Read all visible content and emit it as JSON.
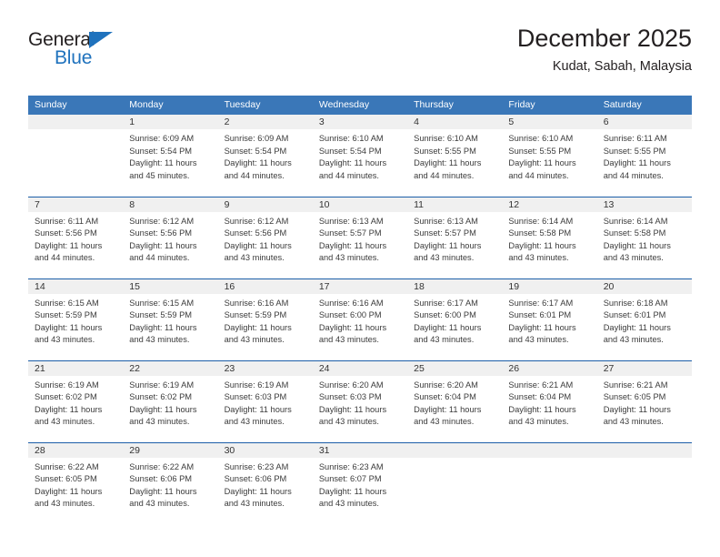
{
  "brand": {
    "name_part1": "General",
    "name_part2": "Blue",
    "triangle_color": "#1f72bd",
    "text_color": "#231f20"
  },
  "header": {
    "title": "December 2025",
    "subtitle": "Kudat, Sabah, Malaysia"
  },
  "theme": {
    "header_bg": "#3a77b8",
    "row_separator": "#1c5ea8",
    "daynum_bg": "#f0f0f0",
    "body_text": "#3b3b3b"
  },
  "weekday_headers": [
    "Sunday",
    "Monday",
    "Tuesday",
    "Wednesday",
    "Thursday",
    "Friday",
    "Saturday"
  ],
  "weeks": [
    [
      {
        "day": "",
        "sunrise": "",
        "sunset": "",
        "daylight_line1": "",
        "daylight_line2": "",
        "empty": true
      },
      {
        "day": "1",
        "sunrise": "Sunrise: 6:09 AM",
        "sunset": "Sunset: 5:54 PM",
        "daylight_line1": "Daylight: 11 hours",
        "daylight_line2": "and 45 minutes.",
        "empty": false
      },
      {
        "day": "2",
        "sunrise": "Sunrise: 6:09 AM",
        "sunset": "Sunset: 5:54 PM",
        "daylight_line1": "Daylight: 11 hours",
        "daylight_line2": "and 44 minutes.",
        "empty": false
      },
      {
        "day": "3",
        "sunrise": "Sunrise: 6:10 AM",
        "sunset": "Sunset: 5:54 PM",
        "daylight_line1": "Daylight: 11 hours",
        "daylight_line2": "and 44 minutes.",
        "empty": false
      },
      {
        "day": "4",
        "sunrise": "Sunrise: 6:10 AM",
        "sunset": "Sunset: 5:55 PM",
        "daylight_line1": "Daylight: 11 hours",
        "daylight_line2": "and 44 minutes.",
        "empty": false
      },
      {
        "day": "5",
        "sunrise": "Sunrise: 6:10 AM",
        "sunset": "Sunset: 5:55 PM",
        "daylight_line1": "Daylight: 11 hours",
        "daylight_line2": "and 44 minutes.",
        "empty": false
      },
      {
        "day": "6",
        "sunrise": "Sunrise: 6:11 AM",
        "sunset": "Sunset: 5:55 PM",
        "daylight_line1": "Daylight: 11 hours",
        "daylight_line2": "and 44 minutes.",
        "empty": false
      }
    ],
    [
      {
        "day": "7",
        "sunrise": "Sunrise: 6:11 AM",
        "sunset": "Sunset: 5:56 PM",
        "daylight_line1": "Daylight: 11 hours",
        "daylight_line2": "and 44 minutes.",
        "empty": false
      },
      {
        "day": "8",
        "sunrise": "Sunrise: 6:12 AM",
        "sunset": "Sunset: 5:56 PM",
        "daylight_line1": "Daylight: 11 hours",
        "daylight_line2": "and 44 minutes.",
        "empty": false
      },
      {
        "day": "9",
        "sunrise": "Sunrise: 6:12 AM",
        "sunset": "Sunset: 5:56 PM",
        "daylight_line1": "Daylight: 11 hours",
        "daylight_line2": "and 43 minutes.",
        "empty": false
      },
      {
        "day": "10",
        "sunrise": "Sunrise: 6:13 AM",
        "sunset": "Sunset: 5:57 PM",
        "daylight_line1": "Daylight: 11 hours",
        "daylight_line2": "and 43 minutes.",
        "empty": false
      },
      {
        "day": "11",
        "sunrise": "Sunrise: 6:13 AM",
        "sunset": "Sunset: 5:57 PM",
        "daylight_line1": "Daylight: 11 hours",
        "daylight_line2": "and 43 minutes.",
        "empty": false
      },
      {
        "day": "12",
        "sunrise": "Sunrise: 6:14 AM",
        "sunset": "Sunset: 5:58 PM",
        "daylight_line1": "Daylight: 11 hours",
        "daylight_line2": "and 43 minutes.",
        "empty": false
      },
      {
        "day": "13",
        "sunrise": "Sunrise: 6:14 AM",
        "sunset": "Sunset: 5:58 PM",
        "daylight_line1": "Daylight: 11 hours",
        "daylight_line2": "and 43 minutes.",
        "empty": false
      }
    ],
    [
      {
        "day": "14",
        "sunrise": "Sunrise: 6:15 AM",
        "sunset": "Sunset: 5:59 PM",
        "daylight_line1": "Daylight: 11 hours",
        "daylight_line2": "and 43 minutes.",
        "empty": false
      },
      {
        "day": "15",
        "sunrise": "Sunrise: 6:15 AM",
        "sunset": "Sunset: 5:59 PM",
        "daylight_line1": "Daylight: 11 hours",
        "daylight_line2": "and 43 minutes.",
        "empty": false
      },
      {
        "day": "16",
        "sunrise": "Sunrise: 6:16 AM",
        "sunset": "Sunset: 5:59 PM",
        "daylight_line1": "Daylight: 11 hours",
        "daylight_line2": "and 43 minutes.",
        "empty": false
      },
      {
        "day": "17",
        "sunrise": "Sunrise: 6:16 AM",
        "sunset": "Sunset: 6:00 PM",
        "daylight_line1": "Daylight: 11 hours",
        "daylight_line2": "and 43 minutes.",
        "empty": false
      },
      {
        "day": "18",
        "sunrise": "Sunrise: 6:17 AM",
        "sunset": "Sunset: 6:00 PM",
        "daylight_line1": "Daylight: 11 hours",
        "daylight_line2": "and 43 minutes.",
        "empty": false
      },
      {
        "day": "19",
        "sunrise": "Sunrise: 6:17 AM",
        "sunset": "Sunset: 6:01 PM",
        "daylight_line1": "Daylight: 11 hours",
        "daylight_line2": "and 43 minutes.",
        "empty": false
      },
      {
        "day": "20",
        "sunrise": "Sunrise: 6:18 AM",
        "sunset": "Sunset: 6:01 PM",
        "daylight_line1": "Daylight: 11 hours",
        "daylight_line2": "and 43 minutes.",
        "empty": false
      }
    ],
    [
      {
        "day": "21",
        "sunrise": "Sunrise: 6:19 AM",
        "sunset": "Sunset: 6:02 PM",
        "daylight_line1": "Daylight: 11 hours",
        "daylight_line2": "and 43 minutes.",
        "empty": false
      },
      {
        "day": "22",
        "sunrise": "Sunrise: 6:19 AM",
        "sunset": "Sunset: 6:02 PM",
        "daylight_line1": "Daylight: 11 hours",
        "daylight_line2": "and 43 minutes.",
        "empty": false
      },
      {
        "day": "23",
        "sunrise": "Sunrise: 6:19 AM",
        "sunset": "Sunset: 6:03 PM",
        "daylight_line1": "Daylight: 11 hours",
        "daylight_line2": "and 43 minutes.",
        "empty": false
      },
      {
        "day": "24",
        "sunrise": "Sunrise: 6:20 AM",
        "sunset": "Sunset: 6:03 PM",
        "daylight_line1": "Daylight: 11 hours",
        "daylight_line2": "and 43 minutes.",
        "empty": false
      },
      {
        "day": "25",
        "sunrise": "Sunrise: 6:20 AM",
        "sunset": "Sunset: 6:04 PM",
        "daylight_line1": "Daylight: 11 hours",
        "daylight_line2": "and 43 minutes.",
        "empty": false
      },
      {
        "day": "26",
        "sunrise": "Sunrise: 6:21 AM",
        "sunset": "Sunset: 6:04 PM",
        "daylight_line1": "Daylight: 11 hours",
        "daylight_line2": "and 43 minutes.",
        "empty": false
      },
      {
        "day": "27",
        "sunrise": "Sunrise: 6:21 AM",
        "sunset": "Sunset: 6:05 PM",
        "daylight_line1": "Daylight: 11 hours",
        "daylight_line2": "and 43 minutes.",
        "empty": false
      }
    ],
    [
      {
        "day": "28",
        "sunrise": "Sunrise: 6:22 AM",
        "sunset": "Sunset: 6:05 PM",
        "daylight_line1": "Daylight: 11 hours",
        "daylight_line2": "and 43 minutes.",
        "empty": false
      },
      {
        "day": "29",
        "sunrise": "Sunrise: 6:22 AM",
        "sunset": "Sunset: 6:06 PM",
        "daylight_line1": "Daylight: 11 hours",
        "daylight_line2": "and 43 minutes.",
        "empty": false
      },
      {
        "day": "30",
        "sunrise": "Sunrise: 6:23 AM",
        "sunset": "Sunset: 6:06 PM",
        "daylight_line1": "Daylight: 11 hours",
        "daylight_line2": "and 43 minutes.",
        "empty": false
      },
      {
        "day": "31",
        "sunrise": "Sunrise: 6:23 AM",
        "sunset": "Sunset: 6:07 PM",
        "daylight_line1": "Daylight: 11 hours",
        "daylight_line2": "and 43 minutes.",
        "empty": false
      },
      {
        "day": "",
        "sunrise": "",
        "sunset": "",
        "daylight_line1": "",
        "daylight_line2": "",
        "empty": true
      },
      {
        "day": "",
        "sunrise": "",
        "sunset": "",
        "daylight_line1": "",
        "daylight_line2": "",
        "empty": true
      },
      {
        "day": "",
        "sunrise": "",
        "sunset": "",
        "daylight_line1": "",
        "daylight_line2": "",
        "empty": true
      }
    ]
  ]
}
